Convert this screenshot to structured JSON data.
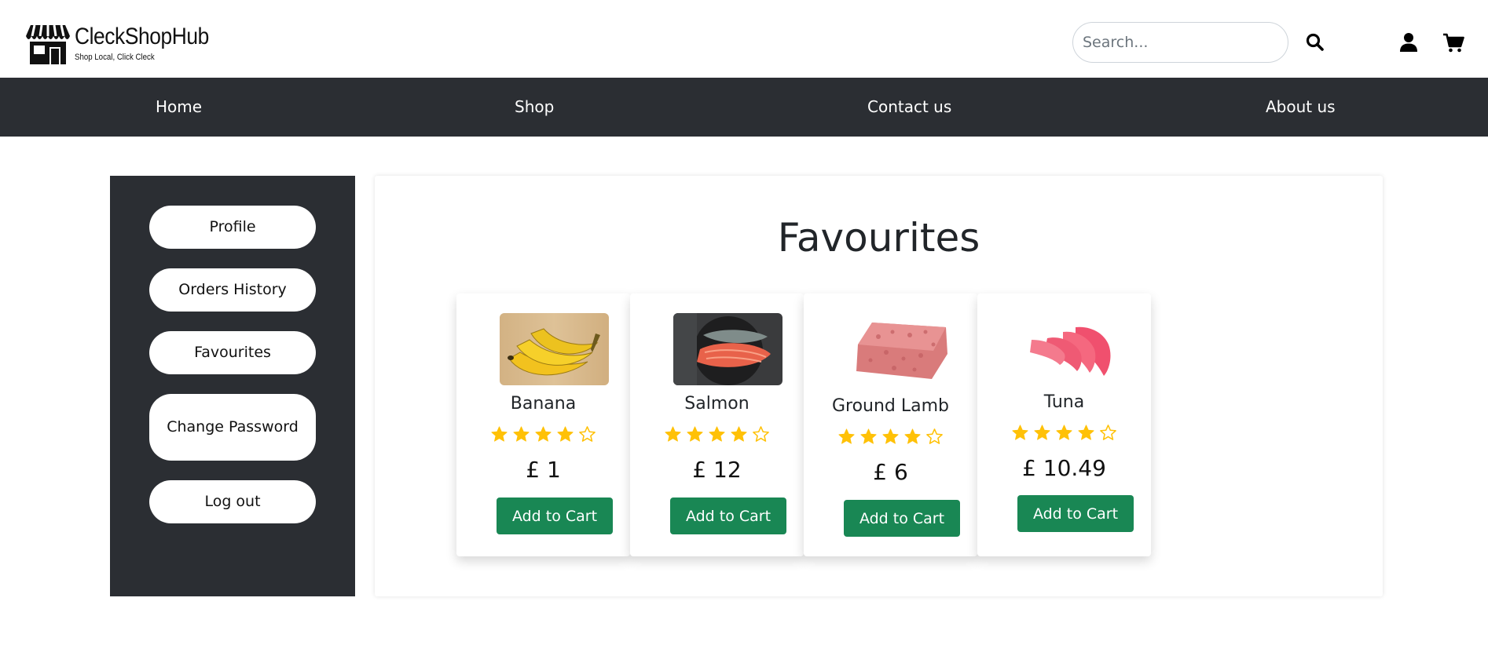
{
  "brand": {
    "name": "CleckShopHub",
    "tagline": "Shop Local, Click Cleck",
    "icon": "storefront-icon"
  },
  "header": {
    "search_placeholder": "Search...",
    "search_icon": "search-icon",
    "user_icon": "user-icon",
    "cart_icon": "cart-icon"
  },
  "nav": {
    "items": [
      {
        "label": "Home"
      },
      {
        "label": "Shop"
      },
      {
        "label": "Contact us"
      },
      {
        "label": "About us"
      }
    ]
  },
  "sidebar": {
    "items": [
      {
        "label": "Profile"
      },
      {
        "label": "Orders History"
      },
      {
        "label": "Favourites"
      },
      {
        "label": "Change Password"
      },
      {
        "label": "Log out"
      }
    ]
  },
  "main": {
    "title": "Favourites",
    "products": [
      {
        "name": "Banana",
        "rating": 4,
        "max_rating": 5,
        "price": "£ 1",
        "cta": "Add to Cart",
        "image": "banana-image"
      },
      {
        "name": "Salmon",
        "rating": 4,
        "max_rating": 5,
        "price": "£ 12",
        "cta": "Add to Cart",
        "image": "salmon-image"
      },
      {
        "name": "Ground Lamb",
        "rating": 4,
        "max_rating": 5,
        "price": "£ 6",
        "cta": "Add to Cart",
        "image": "ground-lamb-image"
      },
      {
        "name": "Tuna",
        "rating": 4,
        "max_rating": 5,
        "price": "£ 10.49",
        "cta": "Add to Cart",
        "image": "tuna-image"
      }
    ]
  },
  "colors": {
    "dark_bar": "#2b2e33",
    "button_green": "#198754",
    "star": "#ffc107"
  }
}
